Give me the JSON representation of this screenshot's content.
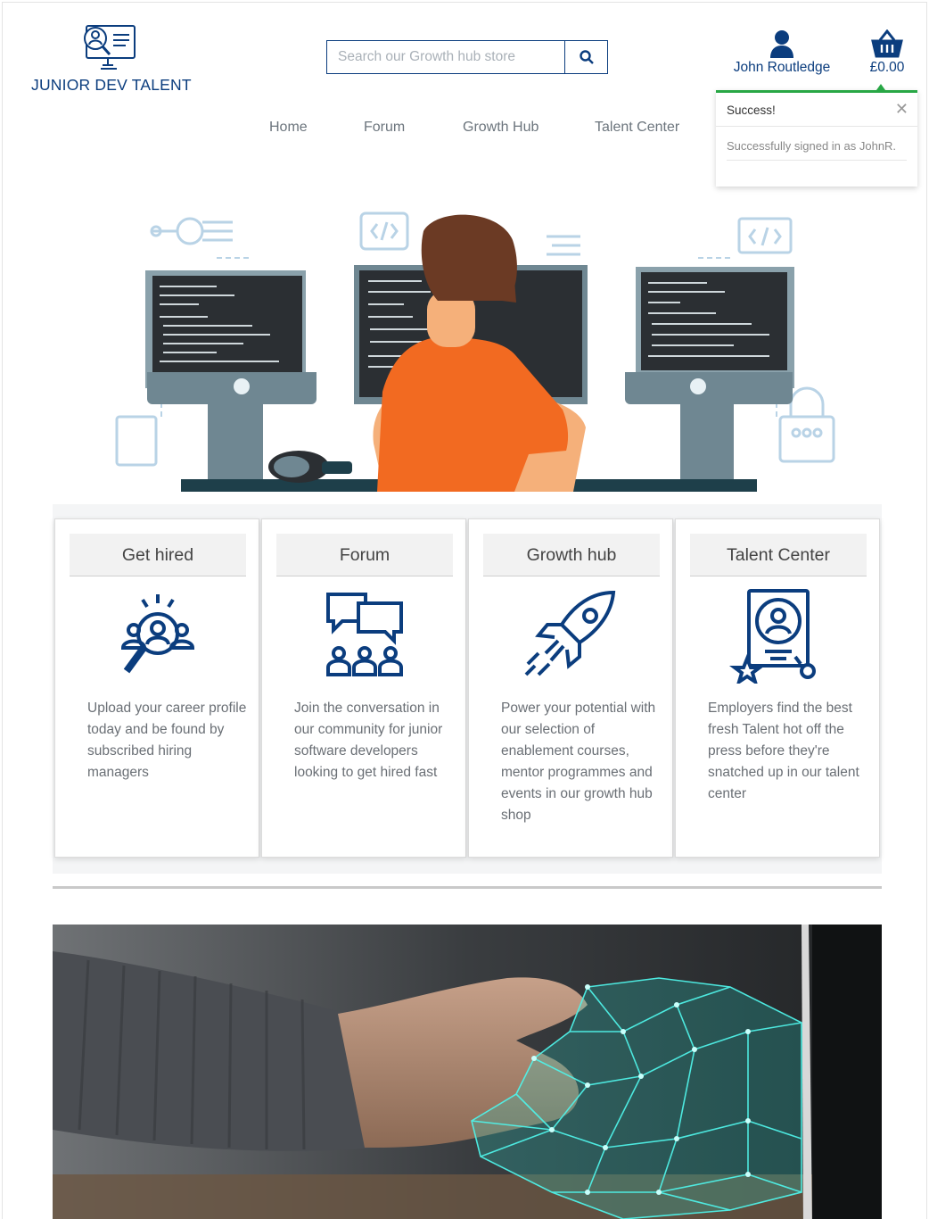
{
  "brand": {
    "name": "JUNIOR DEV TALENT",
    "color": "#0b3d7e"
  },
  "search": {
    "placeholder": "Search our Growth hub store",
    "button_icon": "search-icon"
  },
  "account": {
    "name": "John Routledge",
    "icon": "user-icon"
  },
  "basket": {
    "total": "£0.00",
    "icon": "basket-icon"
  },
  "nav": {
    "items": [
      "Home",
      "Forum",
      "Growth Hub",
      "Talent Center"
    ]
  },
  "toast": {
    "title": "Success!",
    "message": "Successfully signed in as JohnR.",
    "accent": "#28a745",
    "close_icon": "close-icon"
  },
  "hero": {
    "description_icon": "developer-at-desk-illustration"
  },
  "features": [
    {
      "title": "Get hired",
      "icon": "talent-search-icon",
      "text": "Upload your career profile today and be found by subscribed hiring managers"
    },
    {
      "title": "Forum",
      "icon": "community-chat-icon",
      "text": "Join the conversation in our community for junior software developers looking to get hired fast"
    },
    {
      "title": "Growth hub",
      "icon": "rocket-icon",
      "text": "Power your potential with our selection of enablement courses, mentor programmes and events in our growth hub shop"
    },
    {
      "title": "Talent Center",
      "icon": "candidate-profile-icon",
      "text": "Employers find the best fresh Talent hot off the press before they're snatched up in our talent center"
    }
  ],
  "banner": {
    "icon": "digital-handshake-image"
  }
}
